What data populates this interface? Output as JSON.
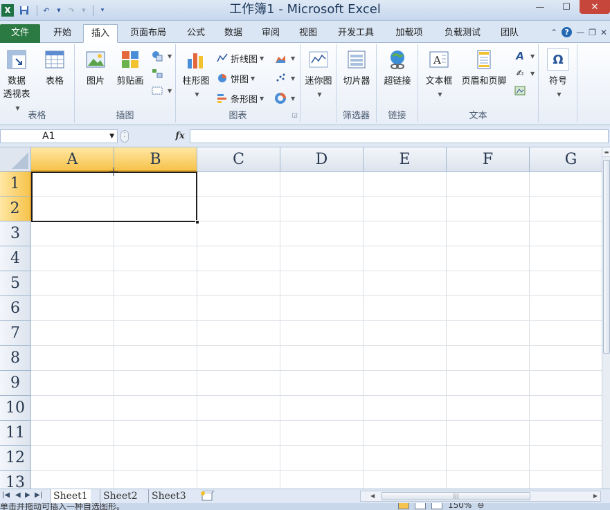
{
  "window": {
    "title": "工作簿1 - Microsoft Excel",
    "app_icon": "excel-icon"
  },
  "tabs": [
    {
      "label": "文件"
    },
    {
      "label": "开始"
    },
    {
      "label": "插入"
    },
    {
      "label": "页面布局"
    },
    {
      "label": "公式"
    },
    {
      "label": "数据"
    },
    {
      "label": "审阅"
    },
    {
      "label": "视图"
    },
    {
      "label": "开发工具"
    },
    {
      "label": "加载项"
    },
    {
      "label": "负载测试"
    },
    {
      "label": "团队"
    }
  ],
  "active_tab": "插入",
  "ribbon": {
    "groups": {
      "tables": {
        "label": "表格",
        "pivot_line1": "数据",
        "pivot_line2": "透视表",
        "table": "表格"
      },
      "illustrations": {
        "label": "插图",
        "picture": "图片",
        "clipart": "剪贴画"
      },
      "charts": {
        "label": "图表",
        "column": "柱形图",
        "line": "折线图",
        "pie": "饼图",
        "bar": "条形图"
      },
      "sparklines": {
        "label": "",
        "sparkline": "迷你图"
      },
      "filter": {
        "label": "筛选器",
        "slicer": "切片器"
      },
      "links": {
        "label": "链接",
        "hyperlink": "超链接"
      },
      "text": {
        "label": "文本",
        "textbox": "文本框",
        "header_footer": "页眉和页脚"
      },
      "symbols": {
        "label": "",
        "symbol": "符号",
        "omega": "Ω"
      }
    }
  },
  "formula_bar": {
    "name_box": "A1",
    "fx": "fx",
    "value": ""
  },
  "grid": {
    "columns": [
      "A",
      "B",
      "C",
      "D",
      "E",
      "F",
      "G"
    ],
    "rows": [
      "1",
      "2",
      "3",
      "4",
      "5",
      "6",
      "7",
      "8",
      "9",
      "10",
      "11",
      "12",
      "13"
    ],
    "selected_columns": [
      "A",
      "B"
    ],
    "selected_rows": [
      "1",
      "2"
    ]
  },
  "sheets": [
    {
      "name": "Sheet1"
    },
    {
      "name": "Sheet2"
    },
    {
      "name": "Sheet3"
    }
  ],
  "active_sheet": "Sheet1",
  "status": {
    "text": "单击并拖动可插入一种自选图形。",
    "zoom": "150%"
  },
  "colors": {
    "file_tab": "#2b7a43",
    "selection_header": "#f6c34c",
    "close_button": "#c7463b"
  }
}
